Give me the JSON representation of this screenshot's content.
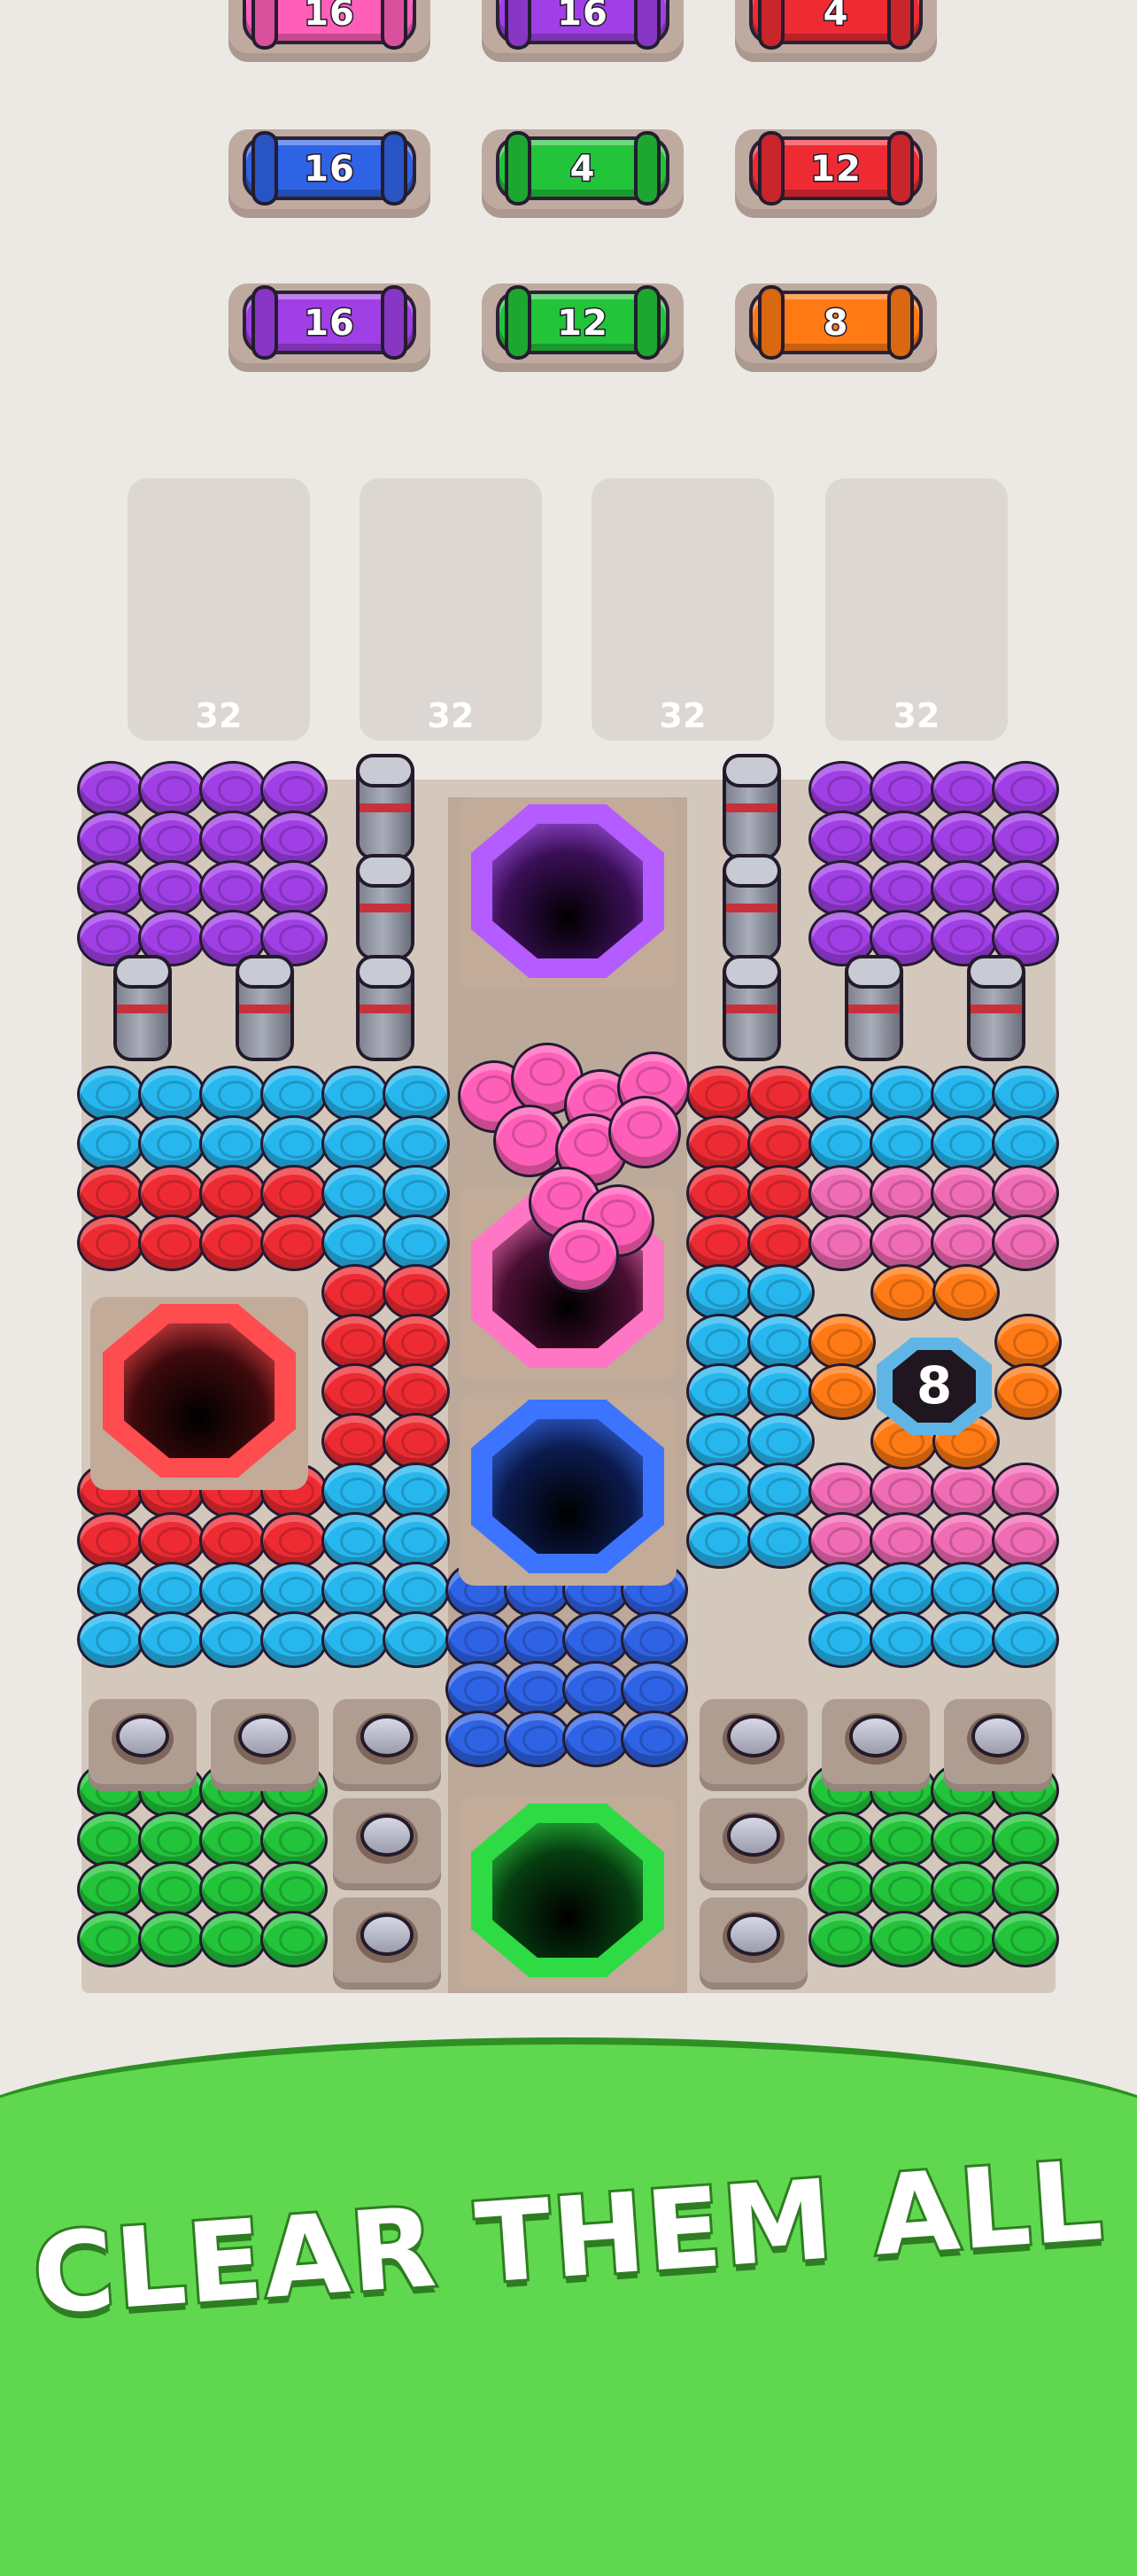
{
  "colors": {
    "pink": "#ff5fb8",
    "purple": "#a03fe6",
    "red": "#ee2b33",
    "blue": "#2f63e6",
    "green": "#22c43a",
    "orange": "#ff7a14",
    "cyan": "#27b7ef",
    "rose": "#f06cb4",
    "background": "#ece9e5",
    "banner": "#5fd84f"
  },
  "spools": [
    {
      "count": "16",
      "color": "pink"
    },
    {
      "count": "16",
      "color": "purple"
    },
    {
      "count": "4",
      "color": "red"
    },
    {
      "count": "16",
      "color": "blue"
    },
    {
      "count": "4",
      "color": "green"
    },
    {
      "count": "12",
      "color": "red"
    },
    {
      "count": "16",
      "color": "purple"
    },
    {
      "count": "12",
      "color": "green"
    },
    {
      "count": "8",
      "color": "orange"
    }
  ],
  "slots": [
    {
      "capacity": "32"
    },
    {
      "capacity": "32"
    },
    {
      "capacity": "32"
    },
    {
      "capacity": "32"
    }
  ],
  "board": {
    "locked_cell_count": "8",
    "hole_colors": [
      "purple",
      "pink",
      "red",
      "blue",
      "green"
    ],
    "yarn_groups": [
      {
        "color": "purple",
        "region": "top-left"
      },
      {
        "color": "purple",
        "region": "top-right"
      },
      {
        "color": "cyan",
        "region": "left"
      },
      {
        "color": "red",
        "region": "left"
      },
      {
        "color": "red",
        "region": "center-right"
      },
      {
        "color": "cyan",
        "region": "right"
      },
      {
        "color": "rose",
        "region": "right"
      },
      {
        "color": "orange",
        "region": "right"
      },
      {
        "color": "blue",
        "region": "bottom-center"
      },
      {
        "color": "green",
        "region": "bottom-left"
      },
      {
        "color": "green",
        "region": "bottom-right"
      }
    ]
  },
  "banner": {
    "text": "CLEAR THEM ALL"
  }
}
